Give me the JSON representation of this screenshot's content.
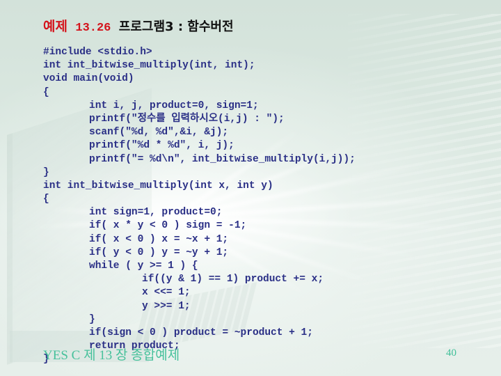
{
  "slide": {
    "title": {
      "label": "예제",
      "number": "13.26",
      "text": "프로그램3 : 함수버전"
    },
    "code_lines": [
      {
        "indent": 0,
        "text": "#include <stdio.h>"
      },
      {
        "indent": 0,
        "text": "int int_bitwise_multiply(int, int);"
      },
      {
        "indent": 0,
        "text": "void main(void)"
      },
      {
        "indent": 0,
        "text": "{"
      },
      {
        "indent": 1,
        "text": "int i, j, product=0, sign=1;"
      },
      {
        "indent": 1,
        "text": "printf(\"정수를 입력하시오(i,j) : \");"
      },
      {
        "indent": 1,
        "text": "scanf(\"%d, %d\",&i, &j);"
      },
      {
        "indent": 1,
        "text": "printf(\"%d * %d\", i, j);"
      },
      {
        "indent": 1,
        "text": "printf(\"= %d\\n\", int_bitwise_multiply(i,j));"
      },
      {
        "indent": 0,
        "text": "}"
      },
      {
        "indent": 0,
        "text": "int int_bitwise_multiply(int x, int y)"
      },
      {
        "indent": 0,
        "text": "{"
      },
      {
        "indent": 1,
        "text": "int sign=1, product=0;"
      },
      {
        "indent": 1,
        "text": "if( x * y < 0 ) sign = -1;"
      },
      {
        "indent": 1,
        "text": "if( x < 0 ) x = ~x + 1;"
      },
      {
        "indent": 1,
        "text": "if( y < 0 ) y = ~y + 1;"
      },
      {
        "indent": 1,
        "text": "while ( y >= 1 ) {"
      },
      {
        "indent": 2,
        "text": "if((y & 1) == 1) product += x;"
      },
      {
        "indent": 2,
        "text": "x <<= 1;"
      },
      {
        "indent": 2,
        "text": "y >>= 1;"
      },
      {
        "indent": 1,
        "text": "}"
      },
      {
        "indent": 1,
        "text": "if(sign < 0 ) product = ~product + 1;"
      },
      {
        "indent": 1,
        "text": "return product;"
      },
      {
        "indent": 0,
        "text": "}"
      }
    ],
    "footer": {
      "left_text": "YES C  제 13 장 종합예제",
      "page_number": "40"
    },
    "colors": {
      "title_accent": "#d4141c",
      "title_text": "#111111",
      "code_text": "#2a2f86",
      "footer_text": "#3fbf98",
      "background": "#dbe8e1"
    }
  }
}
